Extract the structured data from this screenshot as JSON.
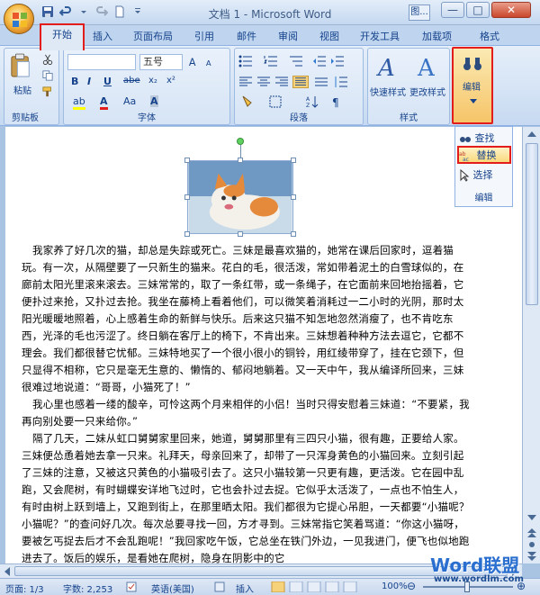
{
  "window": {
    "title": "文档 1 - Microsoft Word",
    "help_label": "图...",
    "controls": [
      "—",
      "□",
      "✕"
    ]
  },
  "tabs": {
    "home": "开始",
    "insert": "插入",
    "page_layout": "页面布局",
    "references": "引用",
    "mailings": "邮件",
    "review": "审阅",
    "view": "视图",
    "developer": "开发工具",
    "addins": "加载项",
    "format": "格式"
  },
  "ribbon": {
    "clipboard": {
      "label": "剪贴板",
      "paste": "粘贴"
    },
    "font": {
      "label": "字体",
      "font_size": "五号",
      "bold": "B",
      "italic": "I",
      "underline": "U",
      "strike": "abe",
      "sub": "x₂",
      "sup": "x²",
      "highlight": "ab",
      "font_color": "A",
      "aa": "Aa",
      "char_shading": "A"
    },
    "paragraph": {
      "label": "段落"
    },
    "styles": {
      "label": "样式",
      "quick_styles": "快速样式",
      "change_styles": "更改样式"
    },
    "editing": {
      "label": "编辑"
    }
  },
  "editing_menu": {
    "find": "查找",
    "replace": "替换",
    "select": "选择",
    "label": "编辑"
  },
  "document": {
    "paragraphs": [
      "我家养了好几次的猫，却总是失踪或死亡。三妹是最喜欢猫的，她常在课后回家时，逗着猫玩。有一次，从隔壁要了一只新生的猫来。花白的毛，很活泼，常如带着泥土的白雪球似的，在廊前太阳光里滚来滚去。三妹常常的，取了一条红带，或一条绳子，在它面前来回地抬摇着，它便扑过来抢，又扑过去抢。我坐在藤椅上看着他们，可以微笑着消耗过一二小时的光阴，那时太阳光暖暖地照着，心上感着生命的新鲜与快乐。后来这只猫不知怎地忽然消瘦了，也不肯吃东西，光泽的毛也污涩了。终日躺在客厅上的椅下，不肯出来。三妹想着种种方法去逗它，它都不理会。我们都很替它忧郁。三妹特地买了一个很小很小的铜铃，用红绫带穿了，挂在它颈下，但只显得不相称，它只是毫无生意的、懒惰的、郁闷地躺着。又一天中午，我从编译所回来，三妹很难过地说道：“哥哥，小猫死了！”",
      "我心里也感着一缕的酸辛，可怜这两个月来相伴的小侣！当时只得安慰着三妹道：“不要紧，我再向别处要一只来给你。”",
      "隔了几天，二妹从虹口舅舅家里回来，她道，舅舅那里有三四只小猫，很有趣，正要给人家。三妹便怂恿着她去拿一只来。礼拜天，母亲回来了，却带了一只浑身黄色的小猫回来。立刻引起了三妹的注意，又被这只黄色的小猫吸引去了。这只小猫较第一只更有趣，更活泼。它在园中乱跑，又会爬树，有时蝴蝶安详地飞过时，它也会扑过去捉。它似乎太活泼了，一点也不怕生人，有时由树上跃到墙上，又跑到街上，在那里晒太阳。我们都很为它提心吊胆，一天都要“小猫呢？小猫呢？”的查问好几次。每次总要寻找一回，方才寻到。三妹常指它笑着骂道：“你这小猫呀，要被乞丐捉去后才不会乱跑呢！”我回家吃午饭，它总坐在铁门外边，一见我进门，便飞也似地跑进去了。饭后的娱乐，是看她在爬树，隐身在阴影中的它"
    ]
  },
  "status": {
    "page": "页面: 1/3",
    "words": "字数: 2,253",
    "language": "英语(美国)",
    "mode": "插入",
    "zoom": "100%",
    "watermark": "Word联盟",
    "watermark_url": "www.wordlm.com"
  }
}
